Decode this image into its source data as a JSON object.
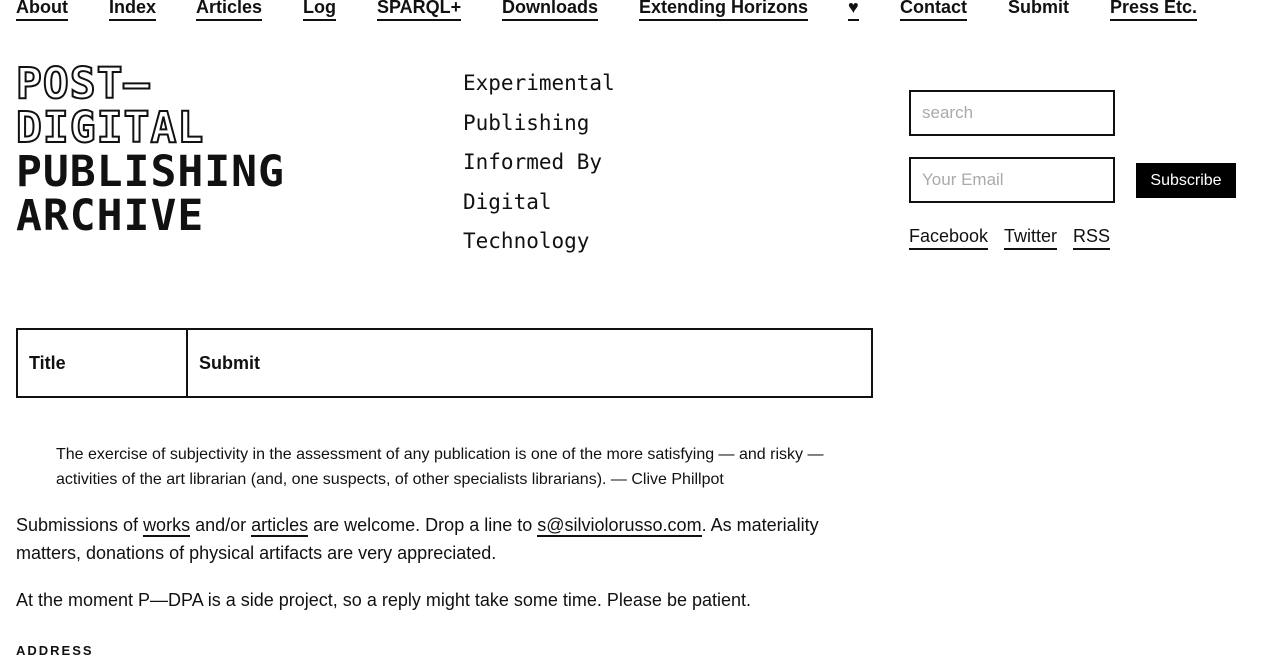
{
  "nav": {
    "items": [
      "About",
      "Index",
      "Articles",
      "Log",
      "SPARQL+",
      "Downloads",
      "Extending Horizons",
      "♥",
      "Contact",
      "Submit",
      "Press Etc."
    ]
  },
  "logo": {
    "line1": "POST—",
    "line2": "DIGITAL",
    "line3": "PUBLISHING",
    "line4": "ARCHIVE"
  },
  "tagline": [
    "Experimental",
    "Publishing",
    "Informed By",
    "Digital",
    "Technology"
  ],
  "sidebar": {
    "search_placeholder": "search",
    "email_placeholder": "Your Email",
    "subscribe_label": "Subscribe",
    "social": [
      "Facebook",
      "Twitter",
      "RSS"
    ]
  },
  "table": {
    "col1": "Title",
    "col2": "Submit"
  },
  "quote": "The exercise of subjectivity in the assessment of any publication is one of the more satisfying — and risky — activities of the art librarian (and, one suspects, of other specialists librarians). — Clive Phillpot",
  "submission": {
    "text1": "Submissions of ",
    "link_works": "works",
    "text2": " and/or ",
    "link_articles": "articles",
    "text3": " are welcome. Drop a line to ",
    "link_email": "s@silviolorusso.com",
    "text4": ". As materiality matters, donations of physical artifacts are very appreciated."
  },
  "note": "At the moment P—DPA is a side project, so a reply might take some time. Please be patient.",
  "address_heading": "ADDRESS"
}
